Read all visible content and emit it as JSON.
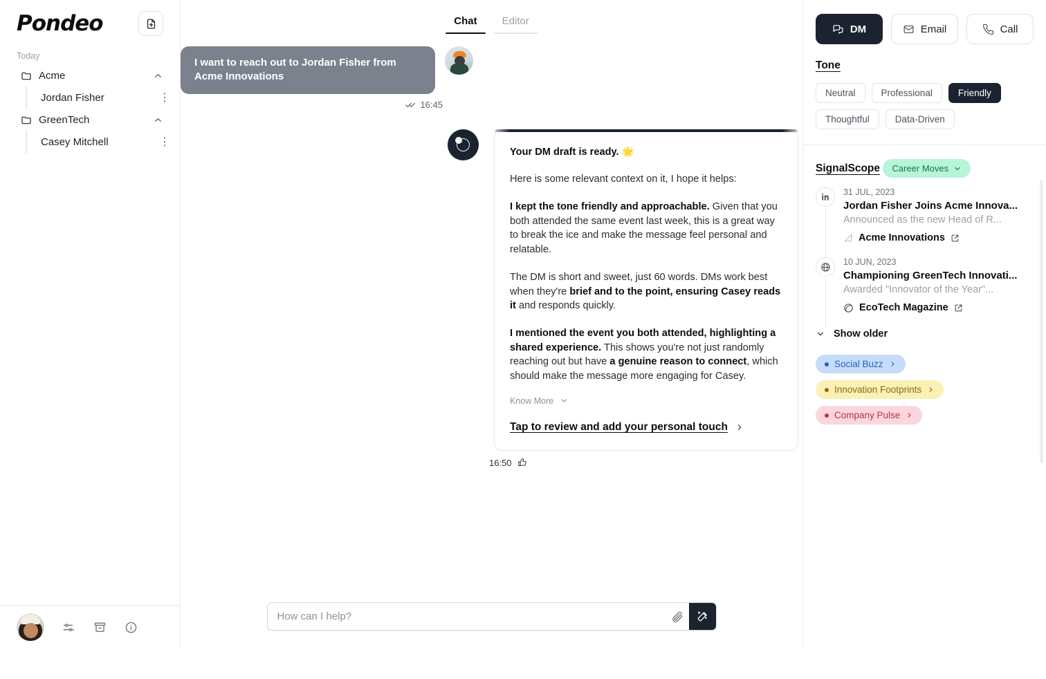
{
  "sidebar": {
    "brand": "Pondeo",
    "new_chat_label": "new-chat",
    "section_label": "Today",
    "folders": [
      {
        "name": "Acme",
        "children": [
          {
            "name": "Jordan Fisher"
          }
        ]
      },
      {
        "name": "GreenTech",
        "children": [
          {
            "name": "Casey Mitchell"
          }
        ]
      }
    ],
    "footer_icons": [
      "avatar",
      "sliders-icon",
      "archive-icon",
      "info-icon"
    ]
  },
  "center": {
    "tabs": [
      {
        "label": "Chat",
        "active": true
      },
      {
        "label": "Editor",
        "active": false
      }
    ],
    "user_message": {
      "text": "I want to reach out to Jordan Fisher from Acme Innovations",
      "time": "16:45",
      "status_icon": "double-check-icon"
    },
    "assistant_message": {
      "heading": "Your DM draft is ready.",
      "heading_emoji": "🌟",
      "intro": "Here is some relevant context on it, I hope it helps:",
      "paragraphs": [
        {
          "bold_lead": "I kept the tone friendly and approachable.",
          "rest": " Given that you both attended the same event last week, this is a great way to break the ice and make the message feel personal and relatable."
        },
        {
          "pre": "The DM is short and sweet, just 60 words. DMs work best when they're ",
          "bold_mid": "brief and to the point, ensuring Casey reads it",
          "post": " and responds quickly."
        },
        {
          "bold_lead": "I mentioned the event you both attended, highlighting a shared experience.",
          "mid": " This shows you're not just randomly reaching out but have ",
          "bold_mid": "a genuine reason to connect",
          "post": ", which should make the message more engaging for Casey."
        }
      ],
      "know_more": "Know More",
      "cta": "Tap to review and add your personal touch",
      "time": "16:50",
      "reaction_icon": "thumbs-up-icon"
    },
    "composer": {
      "placeholder": "How can I help?",
      "value": "",
      "attach_icon": "paperclip-icon",
      "send_icon": "magic-wand-icon"
    }
  },
  "right_panel": {
    "channels": [
      {
        "label": "DM",
        "icon": "chat-bubbles-icon",
        "active": true
      },
      {
        "label": "Email",
        "icon": "envelope-icon",
        "active": false
      },
      {
        "label": "Call",
        "icon": "phone-icon",
        "active": false
      }
    ],
    "tone": {
      "title": "Tone",
      "options": [
        {
          "label": "Neutral",
          "active": false
        },
        {
          "label": "Professional",
          "active": false
        },
        {
          "label": "Friendly",
          "active": true
        },
        {
          "label": "Thoughtful",
          "active": false
        },
        {
          "label": "Data-Driven",
          "active": false
        }
      ]
    },
    "signalscope": {
      "title": "SignalScope",
      "active_filter": {
        "label": "Career Moves",
        "bg": "#b7f5d8",
        "fg": "#17704d"
      },
      "news": [
        {
          "icon": "linkedin-icon",
          "date": "31 JUL, 2023",
          "headline": "Jordan Fisher Joins Acme Innova...",
          "subtitle": "Announced as the new Head of R...",
          "source": "Acme Innovations",
          "source_icon": "bar-chart-icon",
          "external_icon": "external-link-icon"
        },
        {
          "icon": "globe-icon",
          "date": "10 JUN, 2023",
          "headline": "Championing GreenTech Innovati...",
          "subtitle": "Awarded \"Innovator of the Year\"...",
          "source": "EcoTech Magazine",
          "source_icon": "leaf-icon",
          "external_icon": "external-link-icon"
        }
      ],
      "show_older": "Show older",
      "categories": [
        {
          "label": "Social Buzz",
          "bg": "#c7dcfb",
          "fg": "#2b5fb8",
          "dot": "#2b5fb8"
        },
        {
          "label": "Innovation Footprints",
          "bg": "#fbf1b5",
          "fg": "#8a6a16",
          "dot": "#8a6a16"
        },
        {
          "label": "Company Pulse",
          "bg": "#fbd7dd",
          "fg": "#b93149",
          "dot": "#b93149"
        }
      ]
    }
  }
}
